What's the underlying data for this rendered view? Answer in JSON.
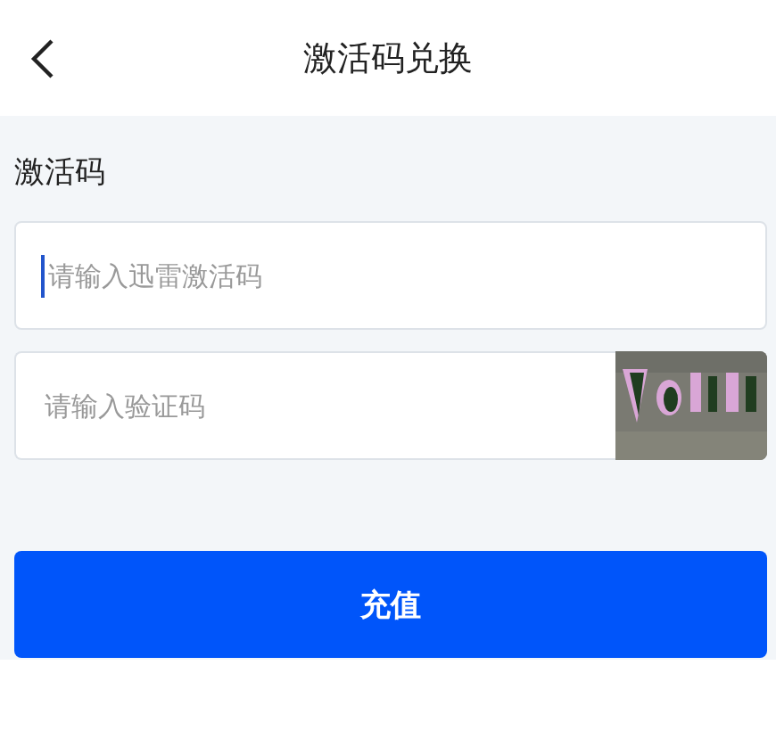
{
  "header": {
    "title": "激活码兑换"
  },
  "form": {
    "label": "激活码",
    "code_field": {
      "placeholder": "请输入迅雷激活码"
    },
    "captcha_field": {
      "placeholder": "请输入验证码"
    },
    "submit_button": "充值"
  }
}
